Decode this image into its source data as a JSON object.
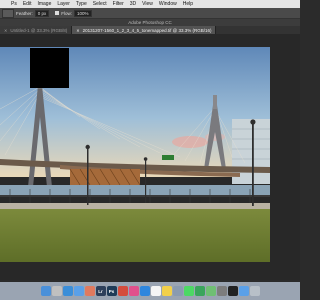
{
  "menubar": {
    "apple_glyph": "",
    "items": [
      "Ps",
      "Edit",
      "Image",
      "Layer",
      "Type",
      "Select",
      "Filter",
      "3D",
      "View",
      "Window",
      "Help"
    ]
  },
  "options": {
    "feather_label": "Feather:",
    "feather_value": "0 px",
    "flow_label": "Flow:",
    "flow_value": "100%"
  },
  "window": {
    "title": "Adobe Photoshop CC"
  },
  "tabs": [
    {
      "label": "Untitled-1 @ 33.3% (RGB/8)",
      "active": false
    },
    {
      "label": "20131207-1560_1_2_3_4_5_tonemapped.tif @ 33.3% (RGB/16)",
      "active": true
    }
  ],
  "dock": {
    "apps": [
      {
        "name": "finder-icon",
        "label": "",
        "color": "#4a90d9"
      },
      {
        "name": "launchpad-icon",
        "label": "",
        "color": "#c0c0c0"
      },
      {
        "name": "safari-icon",
        "label": "",
        "color": "#3b8ed8"
      },
      {
        "name": "mail-icon",
        "label": "",
        "color": "#5aa0e8"
      },
      {
        "name": "photos-icon",
        "label": "",
        "color": "#e07a5f"
      },
      {
        "name": "lightroom-icon",
        "label": "Lr",
        "color": "#2d3f5a"
      },
      {
        "name": "photoshop-icon",
        "label": "Ps",
        "color": "#1f3b57"
      },
      {
        "name": "chrome-icon",
        "label": "",
        "color": "#d44c3c"
      },
      {
        "name": "itunes-icon",
        "label": "",
        "color": "#e0508c"
      },
      {
        "name": "appstore-icon",
        "label": "",
        "color": "#2e86de"
      },
      {
        "name": "calendar-icon",
        "label": "",
        "color": "#f5f5f5"
      },
      {
        "name": "notes-icon",
        "label": "",
        "color": "#f2d04a"
      },
      {
        "name": "preview-icon",
        "label": "",
        "color": "#8a9bb0"
      },
      {
        "name": "messages-icon",
        "label": "",
        "color": "#4cd964"
      },
      {
        "name": "facetime-icon",
        "label": "",
        "color": "#3aa55c"
      },
      {
        "name": "maps-icon",
        "label": "",
        "color": "#6fbf73"
      },
      {
        "name": "settings-icon",
        "label": "",
        "color": "#7d7d7d"
      },
      {
        "name": "terminal-icon",
        "label": "",
        "color": "#222222"
      },
      {
        "name": "folder-icon",
        "label": "",
        "color": "#5aa0e8"
      },
      {
        "name": "trash-icon",
        "label": "",
        "color": "#b8c0c8"
      }
    ]
  }
}
